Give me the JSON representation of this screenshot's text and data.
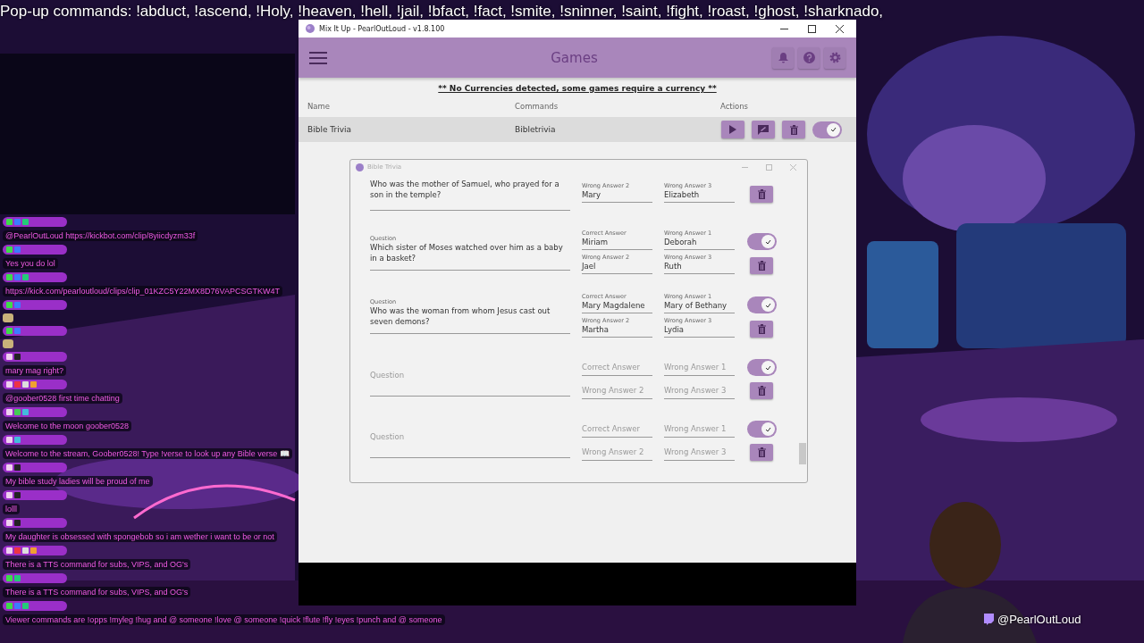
{
  "ticker": "Pop-up commands: !abduct, !ascend, !Holy, !heaven, !hell,  !jail, !bfact, !fact, !smite, !sninner, !saint, !fight, !roast, !ghost, !sharknado,",
  "chat": [
    {
      "kind": "text",
      "badges": [
        {
          "color": "#3ddc4a"
        },
        {
          "color": "#3d7bff"
        },
        {
          "color": "#22cc77"
        }
      ],
      "text": "@PearlOutLoud https://kickbot.com/clip/8yiicdyzm33f"
    },
    {
      "kind": "text",
      "badges": [
        {
          "color": "#3ddc4a"
        },
        {
          "color": "#3d7bff"
        }
      ],
      "text": "Yes you do lol"
    },
    {
      "kind": "text",
      "badges": [
        {
          "color": "#3ddc4a"
        },
        {
          "color": "#3d7bff"
        },
        {
          "color": "#22cc77"
        }
      ],
      "text": "https://kick.com/pearloutloud/clips/clip_01KZC5Y22MX8D76VAPCSGTKW4T"
    },
    {
      "kind": "emote",
      "badges": [
        {
          "color": "#3ddc4a"
        },
        {
          "color": "#3d7bff"
        }
      ]
    },
    {
      "kind": "emote",
      "badges": [
        {
          "color": "#3ddc4a"
        },
        {
          "color": "#3d7bff"
        }
      ]
    },
    {
      "kind": "text",
      "badges": [
        {
          "color": "#f0d0f0"
        },
        {
          "color": "#222222"
        }
      ],
      "text": "mary mag right?"
    },
    {
      "kind": "text",
      "badges": [
        {
          "color": "#f0d0f0"
        },
        {
          "color": "#ee3344"
        },
        {
          "color": "#dddddd"
        },
        {
          "color": "#f0a030"
        }
      ],
      "text": "@goober0528 first time chatting"
    },
    {
      "kind": "text",
      "badges": [
        {
          "color": "#f0d0f0"
        },
        {
          "color": "#44cc55"
        },
        {
          "color": "#44bbdd"
        }
      ],
      "text": "Welcome to the moon goober0528"
    },
    {
      "kind": "text",
      "badges": [
        {
          "color": "#f0d0f0"
        },
        {
          "color": "#44bbdd"
        }
      ],
      "text": "Welcome to the stream, Goober0528! Type !verse to look up any Bible verse 📖"
    },
    {
      "kind": "text",
      "badges": [
        {
          "color": "#f0d0f0"
        },
        {
          "color": "#222222"
        }
      ],
      "text": "My bible study ladies will be proud of me"
    },
    {
      "kind": "text",
      "badges": [
        {
          "color": "#f0d0f0"
        },
        {
          "color": "#222222"
        }
      ],
      "text": "lolll"
    },
    {
      "kind": "text",
      "badges": [
        {
          "color": "#f0d0f0"
        },
        {
          "color": "#222222"
        }
      ],
      "text": "My daughter is obsessed with spongebob so i am wether i want to be or not"
    },
    {
      "kind": "text",
      "badges": [
        {
          "color": "#f0d0f0"
        },
        {
          "color": "#ee3344"
        },
        {
          "color": "#dddddd"
        },
        {
          "color": "#f0a030"
        }
      ],
      "text": "There is a TTS command for subs, VIPS, and OG's"
    },
    {
      "kind": "text",
      "badges": [
        {
          "color": "#3ddc4a"
        },
        {
          "color": "#22cc77"
        }
      ],
      "text": "There is a TTS command for subs, VIPS, and OG's"
    },
    {
      "kind": "text",
      "badges": [
        {
          "color": "#3ddc4a"
        },
        {
          "color": "#3d7bff"
        },
        {
          "color": "#22cc77"
        }
      ],
      "text": "Viewer commands are !opps !myleg !hug and @ someone !love @ someone !quick !flute !fly !eyes !punch and @ someone"
    }
  ],
  "app": {
    "title": "Mix It Up - PearlOutLoud - v1.8.100",
    "header": "Games",
    "notice": "** No Currencies detected, some games require a currency **",
    "columns": [
      "Name",
      "Commands",
      "Actions"
    ],
    "games": [
      {
        "name": "Bible Trivia",
        "command": "Bibletrivia",
        "enabled": true
      }
    ]
  },
  "dialog": {
    "title": "Bible Trivia",
    "entries": [
      {
        "question": {
          "value": "Who was the mother of Samuel, who prayed for a son in the temple?"
        },
        "rows": [
          {
            "fields": [
              {
                "label": "Wrong Answer 2",
                "value": "Mary"
              },
              {
                "label": "Wrong Answer 3",
                "value": "Elizabeth"
              }
            ],
            "kind": "delete"
          }
        ]
      },
      {
        "question": {
          "label": "Question",
          "value": "Which sister of Moses watched over him as a baby in a basket?"
        },
        "rows": [
          {
            "fields": [
              {
                "label": "Correct Answer",
                "value": "Miriam"
              },
              {
                "label": "Wrong Answer 1",
                "value": "Deborah"
              }
            ],
            "kind": "toggle",
            "enabled": true
          },
          {
            "fields": [
              {
                "label": "Wrong Answer 2",
                "value": "Jael"
              },
              {
                "label": "Wrong Answer 3",
                "value": "Ruth"
              }
            ],
            "kind": "delete"
          }
        ]
      },
      {
        "question": {
          "label": "Question",
          "value": "Who was the woman from whom Jesus cast out seven demons?"
        },
        "rows": [
          {
            "fields": [
              {
                "label": "Correct Answer",
                "value": "Mary Magdalene"
              },
              {
                "label": "Wrong Answer 1",
                "value": "Mary of Bethany"
              }
            ],
            "kind": "toggle",
            "enabled": true
          },
          {
            "fields": [
              {
                "label": "Wrong Answer 2",
                "value": "Martha"
              },
              {
                "label": "Wrong Answer 3",
                "value": "Lydia"
              }
            ],
            "kind": "delete"
          }
        ]
      },
      {
        "question": {
          "placeholder": "Question"
        },
        "rows": [
          {
            "fields": [
              {
                "placeholder": "Correct Answer"
              },
              {
                "placeholder": "Wrong Answer 1"
              }
            ],
            "kind": "toggle",
            "enabled": true
          },
          {
            "fields": [
              {
                "placeholder": "Wrong Answer 2"
              },
              {
                "placeholder": "Wrong Answer 3"
              }
            ],
            "kind": "delete"
          }
        ]
      },
      {
        "question": {
          "placeholder": "Question"
        },
        "rows": [
          {
            "fields": [
              {
                "placeholder": "Correct Answer"
              },
              {
                "placeholder": "Wrong Answer 1"
              }
            ],
            "kind": "toggle",
            "enabled": true
          },
          {
            "fields": [
              {
                "placeholder": "Wrong Answer 2"
              },
              {
                "placeholder": "Wrong Answer 3"
              }
            ],
            "kind": "delete"
          }
        ]
      }
    ]
  },
  "webcam": {
    "handle": "@PearlOutLoud"
  }
}
